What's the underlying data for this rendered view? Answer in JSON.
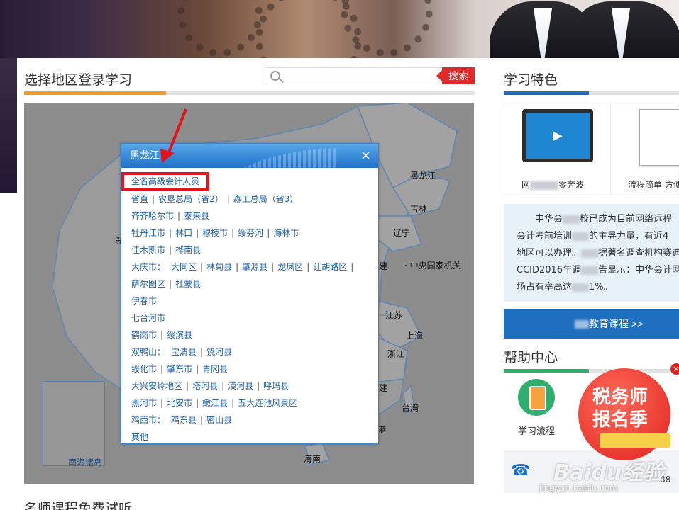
{
  "section_left": {
    "title": "选择地区登录学习",
    "accent": "#f39a2b"
  },
  "search": {
    "placeholder": "",
    "button": "搜索"
  },
  "map_labels": [
    {
      "id": "heilongjiang",
      "text": "黑龙江"
    },
    {
      "id": "jilin",
      "text": "吉林"
    },
    {
      "id": "liaoning",
      "text": "辽宁"
    },
    {
      "id": "central",
      "text": "· 中央国家机关"
    },
    {
      "id": "jiangsu",
      "text": "江苏"
    },
    {
      "id": "shanghai",
      "text": "上海"
    },
    {
      "id": "zhejiang",
      "text": "浙江"
    },
    {
      "id": "taiwan",
      "text": "台湾"
    },
    {
      "id": "hainan",
      "text": "海南"
    },
    {
      "id": "nanhai",
      "text": "南海诸岛"
    },
    {
      "id": "jian",
      "text": "建"
    },
    {
      "id": "jian2",
      "text": "建"
    },
    {
      "id": "gang",
      "text": "港"
    },
    {
      "id": "xin",
      "text": "新"
    }
  ],
  "popup": {
    "title": "黑龙江",
    "close": "×",
    "highlight": "全省高级会计人员",
    "rows": [
      {
        "items": [
          "省直",
          "农垦总局（省2）",
          "森工总局（省3）"
        ]
      },
      {
        "items": [
          "齐齐哈尔市",
          "泰来县"
        ]
      },
      {
        "items": [
          "牡丹江市",
          "林口",
          "穆棱市",
          "绥芬河",
          "海林市"
        ]
      },
      {
        "items": [
          "佳木斯市",
          "桦南县"
        ]
      },
      {
        "label": "大庆市：",
        "items": [
          "大同区",
          "林甸县",
          "肇源县",
          "龙凤区",
          "让胡路区"
        ],
        "trail": true
      },
      {
        "items": [
          "萨尔图区",
          "杜蒙县"
        ]
      },
      {
        "items": [
          "伊春市"
        ]
      },
      {
        "items": [
          "七台河市"
        ]
      },
      {
        "items": [
          "鹤岗市",
          "绥滨县"
        ]
      },
      {
        "label": "双鸭山：",
        "items": [
          "宝清县",
          "饶河县"
        ]
      },
      {
        "items": [
          "绥化市",
          "肇东市",
          "青冈县"
        ]
      },
      {
        "items": [
          "大兴安岭地区",
          "塔河县",
          "漠河县",
          "呼玛县"
        ]
      },
      {
        "items": [
          "黑河市",
          "北安市",
          "嫩江县",
          "五大连池风景区"
        ]
      },
      {
        "label": "鸡西市：",
        "items": [
          "鸡东县",
          "密山县"
        ]
      },
      {
        "items": [
          "其他"
        ]
      }
    ],
    "separator": "|"
  },
  "section_features": {
    "title": "学习特色",
    "accent": "#1f6fc0"
  },
  "features": [
    {
      "label_pre": "网",
      "label_post": "零奔波"
    },
    {
      "label": "流程简单 方便"
    }
  ],
  "intro": {
    "lines": [
      {
        "pre": "中华会",
        "post": "校已成为目前网络远程"
      },
      {
        "pre": "会计考前培训",
        "post": "的主导力量，有近4"
      },
      {
        "pre": "地区可以办理。",
        "post": "据著名调查机构赛迪"
      },
      {
        "pre": "CCID2016年调",
        "post": "告显示：中华会计网"
      },
      {
        "pre": "场占有率高达",
        "post": "1%。"
      }
    ]
  },
  "edu_button": "教育课程 >>",
  "section_help": {
    "title": "帮助中心",
    "accent": "#2fae6e"
  },
  "help_item": "学习流程",
  "ad": {
    "text1": "税务师",
    "text2": "报名季",
    "close": "×"
  },
  "footer_num": "88",
  "watermark": {
    "main": "Baidu经验",
    "sub": "jingyan.baidu.com"
  },
  "bottom_title": "名师课程免费试听"
}
